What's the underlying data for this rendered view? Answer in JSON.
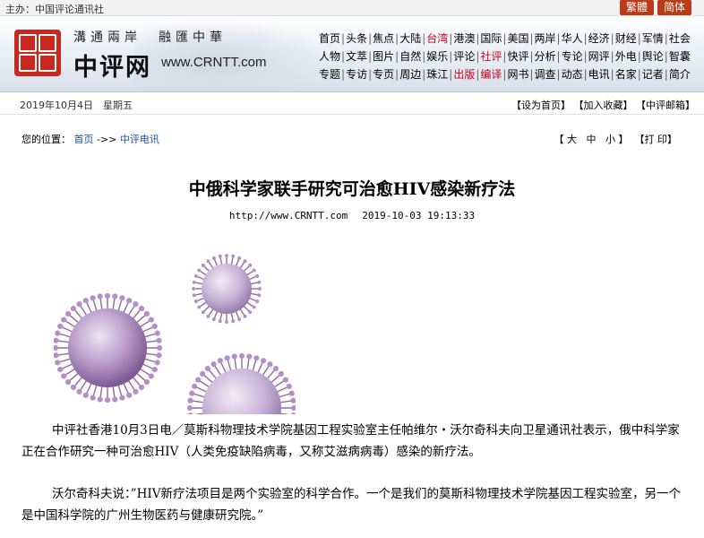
{
  "top_bar": {
    "host_text": "主办：中国评论通讯社",
    "lang_traditional": "繁體",
    "lang_simplified": "简体"
  },
  "header": {
    "slogan": "溝通兩岸　融匯中華",
    "brand": "中评网",
    "url": "www.CRNTT.com",
    "nav_rows": [
      [
        {
          "label": "首页",
          "color": "#000000"
        },
        {
          "label": "头条",
          "color": "#000000"
        },
        {
          "label": "焦点",
          "color": "#000000"
        },
        {
          "label": "大陆",
          "color": "#000000"
        },
        {
          "label": "台湾",
          "color": "#d0021b"
        },
        {
          "label": "港澳",
          "color": "#000000"
        },
        {
          "label": "国际",
          "color": "#000000"
        },
        {
          "label": "美国",
          "color": "#000000"
        },
        {
          "label": "两岸",
          "color": "#000000"
        },
        {
          "label": "华人",
          "color": "#000000"
        },
        {
          "label": "经济",
          "color": "#000000"
        },
        {
          "label": "财经",
          "color": "#000000"
        },
        {
          "label": "军情",
          "color": "#000000"
        },
        {
          "label": "社会",
          "color": "#000000"
        }
      ],
      [
        {
          "label": "人物",
          "color": "#000000"
        },
        {
          "label": "文萃",
          "color": "#000000"
        },
        {
          "label": "图片",
          "color": "#000000"
        },
        {
          "label": "自然",
          "color": "#000000"
        },
        {
          "label": "娱乐",
          "color": "#000000"
        },
        {
          "label": "评论",
          "color": "#000000"
        },
        {
          "label": "社评",
          "color": "#d0021b"
        },
        {
          "label": "快评",
          "color": "#000000"
        },
        {
          "label": "分析",
          "color": "#000000"
        },
        {
          "label": "专论",
          "color": "#000000"
        },
        {
          "label": "网评",
          "color": "#000000"
        },
        {
          "label": "外电",
          "color": "#000000"
        },
        {
          "label": "舆论",
          "color": "#000000"
        },
        {
          "label": "智囊",
          "color": "#000000"
        }
      ],
      [
        {
          "label": "专题",
          "color": "#000000"
        },
        {
          "label": "专访",
          "color": "#000000"
        },
        {
          "label": "专页",
          "color": "#000000"
        },
        {
          "label": "周边",
          "color": "#000000"
        },
        {
          "label": "珠江",
          "color": "#000000"
        },
        {
          "label": "出版",
          "color": "#d0021b"
        },
        {
          "label": "编译",
          "color": "#d0021b"
        },
        {
          "label": "网书",
          "color": "#000000"
        },
        {
          "label": "调查",
          "color": "#000000"
        },
        {
          "label": "动态",
          "color": "#000000"
        },
        {
          "label": "电讯",
          "color": "#000000"
        },
        {
          "label": "名家",
          "color": "#000000"
        },
        {
          "label": "记者",
          "color": "#000000"
        },
        {
          "label": "简介",
          "color": "#000000"
        }
      ]
    ]
  },
  "date_bar": {
    "date": "2019年10月4日　星期五",
    "set_home": "【设为首页】",
    "add_favorite": "【加入收藏】",
    "mailbox": "【中评邮箱】"
  },
  "breadcrumb": {
    "prefix": "您的位置：",
    "home": "首页",
    "arrow": " ->> ",
    "section": "中评电讯"
  },
  "tools": {
    "open": "【",
    "large": "大",
    "medium": "中",
    "small": "小",
    "close": "】",
    "print": "【打 印】"
  },
  "article": {
    "title": "中俄科学家联手研究可治愈HIV感染新疗法",
    "source_url": "http://www.CRNTT.com",
    "timestamp": "2019-10-03 19:13:33",
    "image_alt": "virus-illustration",
    "paragraphs": [
      "中评社香港10月3日电／莫斯科物理技术学院基因工程实验室主任帕维尔・沃尔奇科夫向卫星通讯社表示，俄中科学家正在合作研究一种可治愈HIV（人类免疫缺陷病毒，又称艾滋病病毒）感染的新疗法。",
      "沃尔奇科夫说：”HIV新疗法项目是两个实验室的科学合作。一个是我们的莫斯科物理技术学院基因工程实验室，另一个是中国科学院的广州生物医药与健康研究院。”"
    ]
  },
  "colors": {
    "accent_red": "#b93b17",
    "link_blue": "#1a4fa3",
    "nav_highlight": "#d0021b"
  }
}
